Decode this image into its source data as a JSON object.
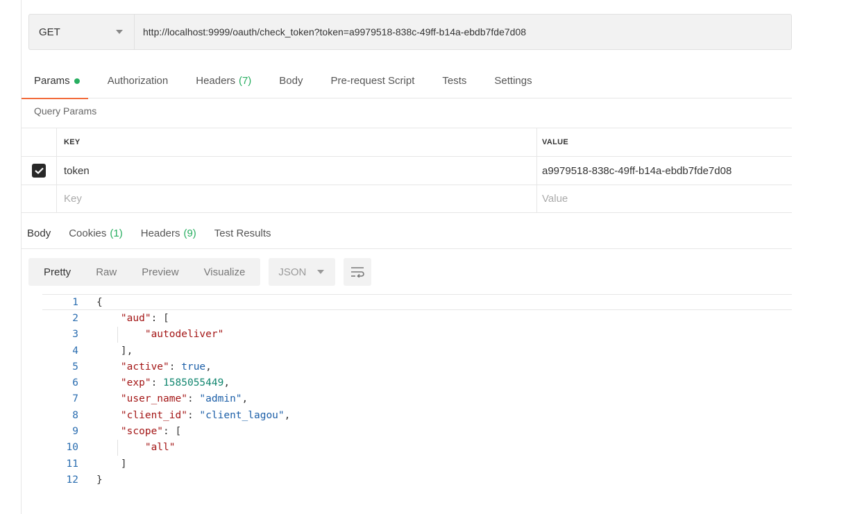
{
  "request": {
    "method": "GET",
    "url": "http://localhost:9999/oauth/check_token?token=a9979518-838c-49ff-b14a-ebdb7fde7d08"
  },
  "request_tabs": {
    "params": "Params",
    "authorization": "Authorization",
    "headers": "Headers",
    "headers_count": "(7)",
    "body": "Body",
    "pre_request": "Pre-request Script",
    "tests": "Tests",
    "settings": "Settings"
  },
  "query_params": {
    "title": "Query Params",
    "key_header": "KEY",
    "value_header": "VALUE",
    "rows": [
      {
        "key": "token",
        "value": "a9979518-838c-49ff-b14a-ebdb7fde7d08",
        "checked": true
      }
    ],
    "key_placeholder": "Key",
    "value_placeholder": "Value"
  },
  "response_tabs": {
    "body": "Body",
    "cookies": "Cookies",
    "cookies_count": "(1)",
    "headers": "Headers",
    "headers_count": "(9)",
    "test_results": "Test Results"
  },
  "body_toolbar": {
    "pretty": "Pretty",
    "raw": "Raw",
    "preview": "Preview",
    "visualize": "Visualize",
    "format": "JSON",
    "wrap_icon": "wrap-lines-icon"
  },
  "response_body": {
    "line_numbers": [
      "1",
      "2",
      "3",
      "4",
      "5",
      "6",
      "7",
      "8",
      "9",
      "10",
      "11",
      "12"
    ],
    "open_brace": "{",
    "aud_key": "\"aud\"",
    "aud_open": ": [",
    "aud_value": "\"autodeliver\"",
    "aud_close": "],",
    "active_key": "\"active\"",
    "active_value": "true",
    "exp_key": "\"exp\"",
    "exp_value": "1585055449",
    "user_name_key": "\"user_name\"",
    "user_name_value": "\"admin\"",
    "client_id_key": "\"client_id\"",
    "client_id_value": "\"client_lagou\"",
    "scope_key": "\"scope\"",
    "scope_open": ": [",
    "scope_value": "\"all\"",
    "scope_close": "]",
    "close_brace": "}"
  },
  "colors": {
    "accent": "#f26b3a",
    "status_green": "#27ae60"
  }
}
